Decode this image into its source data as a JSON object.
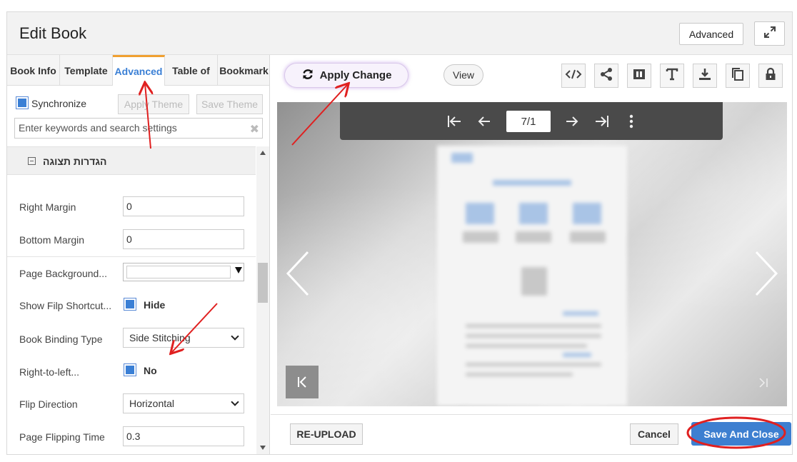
{
  "header": {
    "title": "Edit Book",
    "advanced_label": "Advanced",
    "expand_icon": "expand-icon"
  },
  "tabs": [
    {
      "label": "Book Info",
      "active": false
    },
    {
      "label": "Template",
      "active": false
    },
    {
      "label": "Advanced",
      "active": true
    },
    {
      "label": "Table of",
      "active": false
    },
    {
      "label": "Bookmark",
      "active": false
    }
  ],
  "settings_panel": {
    "synchronize_label": "Synchronize",
    "synchronize_checked": true,
    "apply_theme_label": "Apply Theme",
    "save_theme_label": "Save Theme",
    "search_placeholder": "Enter keywords and search settings",
    "section_title": "הגדרות תצוגה",
    "rows": [
      {
        "label": "Right Margin",
        "value": "0",
        "type": "input"
      },
      {
        "label": "Bottom Margin",
        "value": "0",
        "type": "input"
      },
      {
        "label": "Page Background...",
        "value": "",
        "type": "color"
      },
      {
        "label": "Show Filp Shortcut...",
        "value": "Hide",
        "type": "checkbox",
        "checked": true
      },
      {
        "label": "Book Binding Type",
        "value": "Side Stitching",
        "type": "select"
      },
      {
        "label": "Right-to-left...",
        "value": "No",
        "type": "checkbox",
        "checked": true
      },
      {
        "label": "Flip Direction",
        "value": "Horizontal",
        "type": "select"
      },
      {
        "label": "Page Flipping Time",
        "value": "0.3",
        "type": "input"
      }
    ]
  },
  "preview_toolbar": {
    "apply_change_label": "Apply Change",
    "view_label": "View",
    "tools": [
      "code-icon",
      "share-icon",
      "columns-icon",
      "text-icon",
      "download-icon",
      "copy-icon",
      "lock-icon"
    ]
  },
  "viewer": {
    "page_indicator": "7/1",
    "nav_icons": [
      "first-page-icon",
      "prev-page-icon",
      "next-page-icon",
      "last-page-icon",
      "more-icon"
    ]
  },
  "footer": {
    "reupload_label": "RE-UPLOAD",
    "cancel_label": "Cancel",
    "save_close_label": "Save And Close"
  },
  "colors": {
    "accent_blue": "#3a7fd5",
    "tab_active_border": "#f0a030",
    "annotation_red": "#e02020",
    "save_button": "#3d7fd0"
  }
}
